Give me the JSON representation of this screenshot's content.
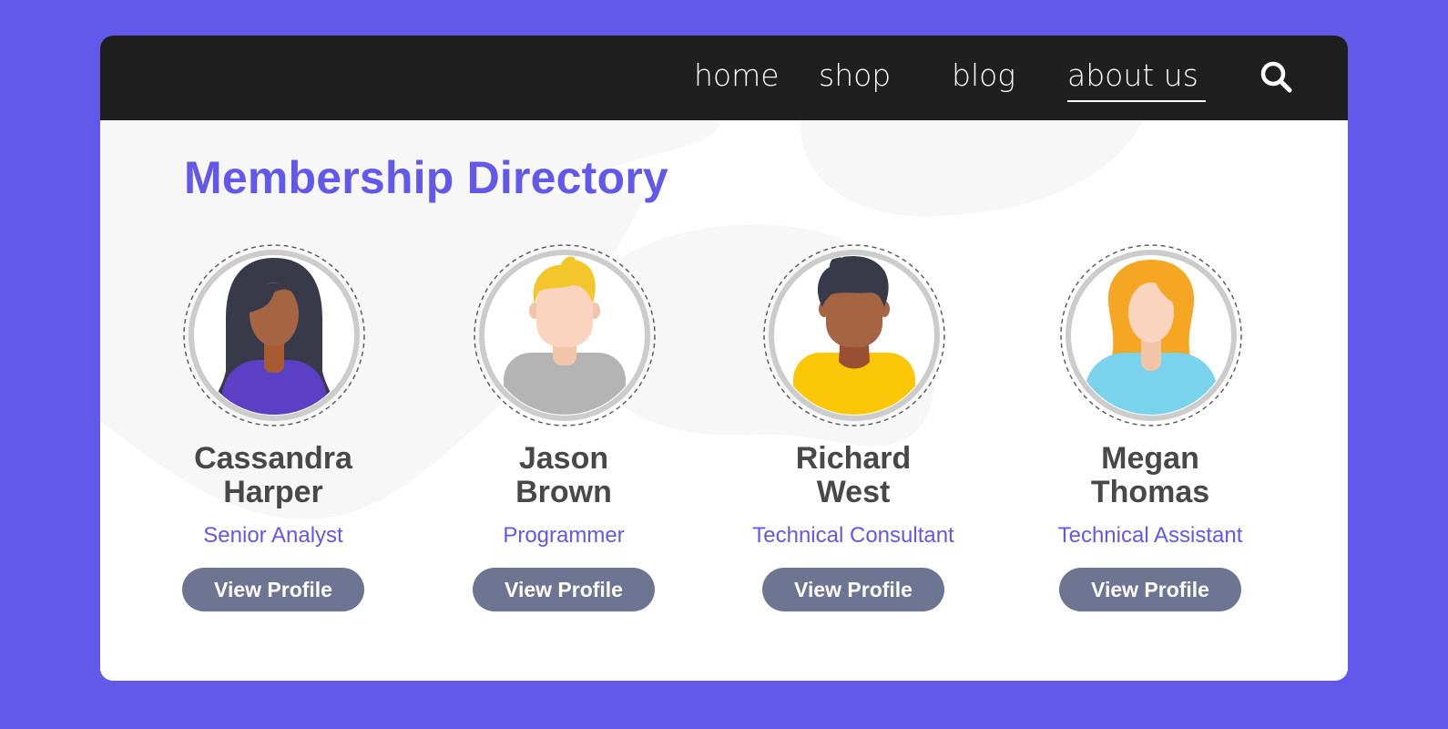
{
  "nav": {
    "links": [
      {
        "label": "home",
        "active": false
      },
      {
        "label": "shop",
        "active": false
      },
      {
        "label": "blog",
        "active": false
      },
      {
        "label": "about us",
        "active": true
      }
    ],
    "search_icon": "search-icon"
  },
  "page": {
    "title": "Membership Directory"
  },
  "members": [
    {
      "name_line1": "Cassandra",
      "name_line2": "Harper",
      "role": "Senior Analyst",
      "button": "View Profile",
      "avatar": "woman-long-dark-hair"
    },
    {
      "name_line1": "Jason",
      "name_line2": "Brown",
      "role": "Programmer",
      "button": "View Profile",
      "avatar": "man-blond-hair"
    },
    {
      "name_line1": "Richard",
      "name_line2": "West",
      "role": "Technical Consultant",
      "button": "View Profile",
      "avatar": "man-dark-hair"
    },
    {
      "name_line1": "Megan",
      "name_line2": "Thomas",
      "role": "Technical Assistant",
      "button": "View Profile",
      "avatar": "woman-orange-hair"
    }
  ],
  "colors": {
    "background": "#6258ea",
    "navbar": "#1f1f1f",
    "accent": "#6258ea",
    "button": "#6e7593",
    "name_text": "#484848"
  }
}
